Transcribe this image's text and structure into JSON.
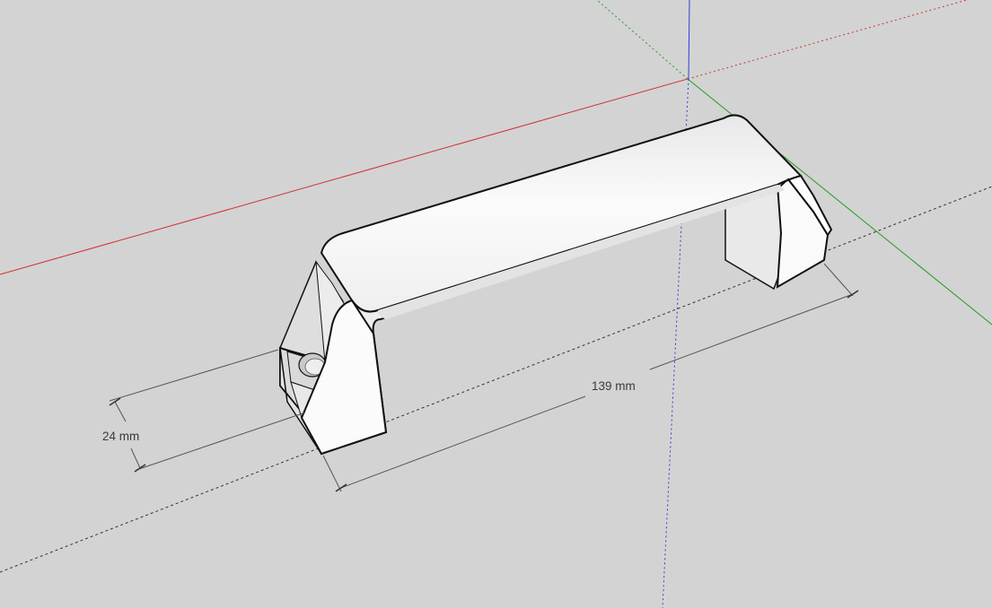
{
  "viewport": {
    "background": "#d3d3d3",
    "axis_colors": {
      "red_axis": "#d23030",
      "green_axis": "#1f9e1f",
      "blue_axis": "#2f3fd8"
    },
    "model_color": "#f7f7f7",
    "edge_color": "#111111"
  },
  "dimensions": {
    "length": {
      "label": "139 mm"
    },
    "height": {
      "label": "24 mm"
    }
  }
}
